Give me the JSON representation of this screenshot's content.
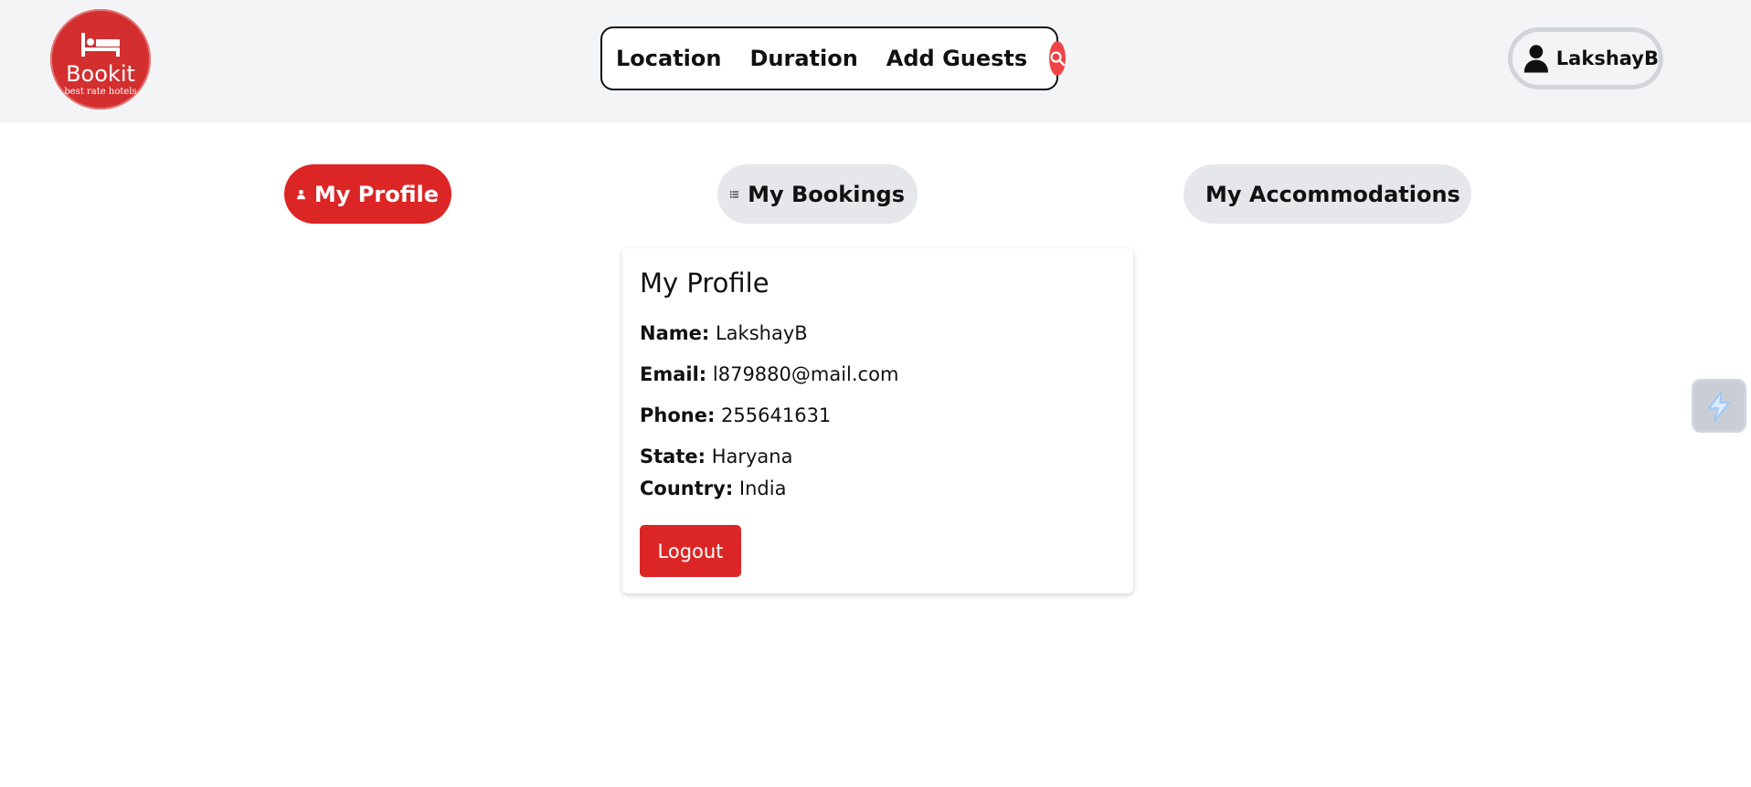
{
  "header": {
    "logo": {
      "name": "Bookit",
      "tagline": "best rate hotels",
      "icon": "bed-icon"
    },
    "search": {
      "location_label": "Location",
      "duration_label": "Duration",
      "guests_label": "Add Guests",
      "button_icon": "search-icon"
    },
    "user": {
      "name": "LakshayB",
      "icon": "user-icon"
    }
  },
  "tabs": [
    {
      "label": "My Profile",
      "icon": "user-icon",
      "active": true
    },
    {
      "label": "My Bookings",
      "icon": "list-icon",
      "active": false
    },
    {
      "label": "My Accommodations",
      "icon": "building-icon",
      "active": false
    }
  ],
  "profile": {
    "title": "My Profile",
    "fields": [
      {
        "label": "Name:",
        "value": "LakshayB"
      },
      {
        "label": "Email:",
        "value": "l879880@mail.com"
      },
      {
        "label": "Phone:",
        "value": "255641631"
      },
      {
        "label": "State:",
        "value": "Haryana"
      },
      {
        "label": "Country:",
        "value": "India"
      }
    ],
    "logout_label": "Logout"
  },
  "floating_widget": {
    "icon": "lightning-icon"
  },
  "colors": {
    "brand_red": "#dc2626",
    "header_bg": "#f3f4f6",
    "tab_inactive_bg": "#e5e7eb",
    "search_button": "#ef4444"
  }
}
